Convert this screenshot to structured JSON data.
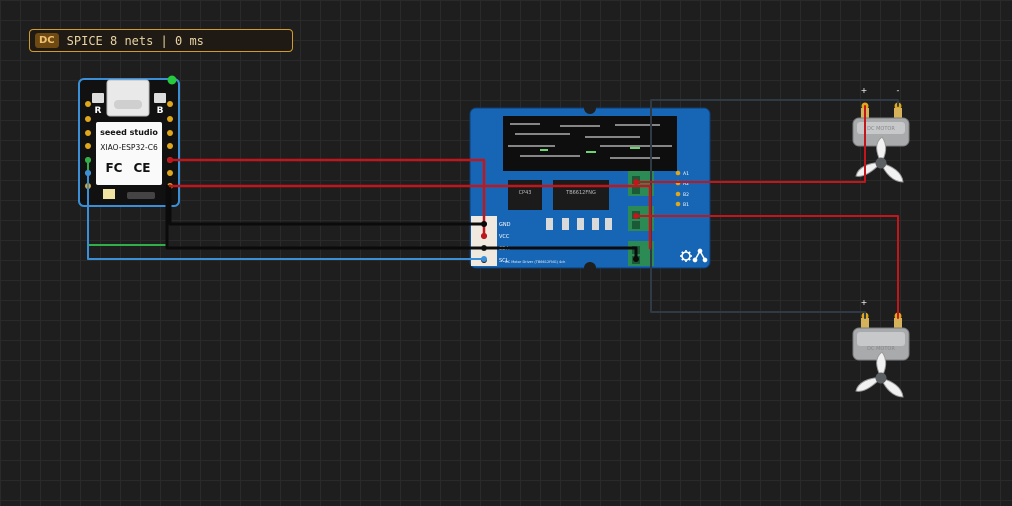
{
  "status": {
    "mode": "DC",
    "text": "SPICE 8 nets | 0 ms"
  },
  "board": {
    "brand": "seeed studio",
    "model": "XIAO-ESP32-C6",
    "cert_fc": "FC",
    "cert_ce": "CE",
    "button_r": "R",
    "button_b": "B",
    "power_led_color": "#27c93f"
  },
  "driver": {
    "chip_left": "CP43",
    "chip_right": "TB6612FNG",
    "pins": [
      "GND",
      "VCC",
      "SDA",
      "SCL"
    ],
    "out_labels": [
      "A1",
      "A2",
      "B2",
      "B1"
    ],
    "caption": "DC Motor Driver (TB6612FNG) 4ch",
    "settings_icon": "gear-icon",
    "flip_icon": "flip-icon"
  },
  "motors": [
    {
      "label": "DC MOTOR",
      "plus": "+",
      "minus": "-"
    },
    {
      "label": "DC MOTOR",
      "plus": "+",
      "minus": ""
    }
  ],
  "colors": {
    "wire_red": "#c0161c",
    "wire_black": "#0b0b0b",
    "wire_blue": "#3b8fd6",
    "wire_green": "#2fae4a",
    "wire_gray": "#2f3a45",
    "board_blue": "#1766b5",
    "accent": "#d39b2a"
  }
}
